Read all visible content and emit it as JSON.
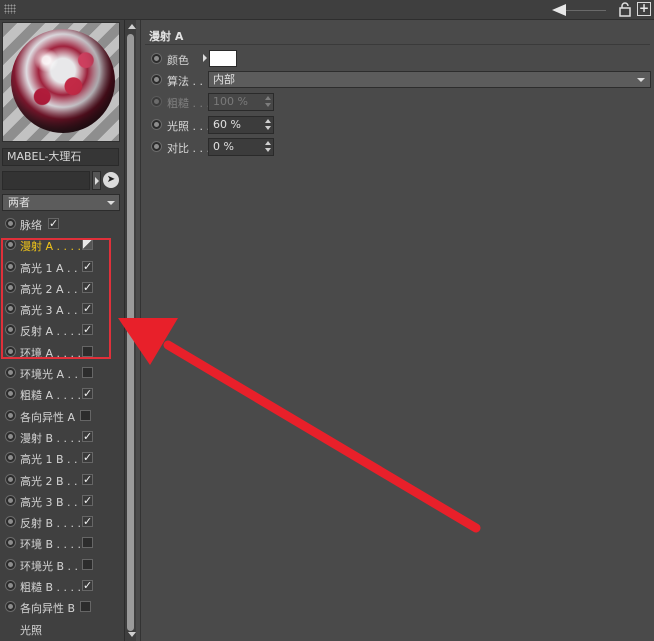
{
  "material": {
    "name": "MABEL-大理石",
    "filter_value": "两者"
  },
  "channels": [
    {
      "label": "脉络",
      "radio": true,
      "check": "on",
      "active": false
    },
    {
      "label": "漫射 A . . . .",
      "radio": true,
      "check": "part",
      "active": true
    },
    {
      "label": "高光 1 A . . .",
      "radio": true,
      "check": "on",
      "active": false
    },
    {
      "label": "高光 2 A . . .",
      "radio": true,
      "check": "on",
      "active": false
    },
    {
      "label": "高光 3 A . . .",
      "radio": true,
      "check": "on",
      "active": false
    },
    {
      "label": "反射 A . . . .",
      "radio": true,
      "check": "on",
      "active": false
    },
    {
      "label": "环境 A . . . .",
      "radio": true,
      "check": "off",
      "active": false
    },
    {
      "label": "环境光 A . . .",
      "radio": true,
      "check": "off",
      "active": false
    },
    {
      "label": "粗糙 A . . . .",
      "radio": true,
      "check": "on",
      "active": false
    },
    {
      "label": "各向异性 A",
      "radio": true,
      "check": "off",
      "active": false
    },
    {
      "label": "漫射 B . . . .",
      "radio": true,
      "check": "on",
      "active": false
    },
    {
      "label": "高光 1 B . . .",
      "radio": true,
      "check": "on",
      "active": false
    },
    {
      "label": "高光 2 B . . .",
      "radio": true,
      "check": "on",
      "active": false
    },
    {
      "label": "高光 3 B . . .",
      "radio": true,
      "check": "on",
      "active": false
    },
    {
      "label": "反射 B . . . .",
      "radio": true,
      "check": "on",
      "active": false
    },
    {
      "label": "环境 B . . . .",
      "radio": true,
      "check": "off",
      "active": false
    },
    {
      "label": "环境光 B . . .",
      "radio": true,
      "check": "off",
      "active": false
    },
    {
      "label": "粗糙 B . . . .",
      "radio": true,
      "check": "on",
      "active": false
    },
    {
      "label": "各向异性 B",
      "radio": true,
      "check": "off",
      "active": false
    },
    {
      "label": "光照",
      "radio": false,
      "check": "none",
      "active": false
    }
  ],
  "section": {
    "title": "漫射 A",
    "color_label": "颜色",
    "algorithm_label": "算法 . .",
    "algorithm_value": "内部",
    "roughness_label": "粗糙 . . .",
    "roughness_value": "100 %",
    "illumination_label": "光照 . . .",
    "illumination_value": "60 %",
    "contrast_label": "对比 . . .",
    "contrast_value": "0 %"
  },
  "colors": {
    "swatch": "#ffffff",
    "highlight": "#e0303a",
    "active_channel": "#f0c419"
  },
  "icons": {
    "grip": "grip-icon",
    "back": "back-arrow-icon",
    "lock": "lock-icon",
    "new_panel": "new-panel-icon",
    "cursor": "pointer-icon"
  }
}
